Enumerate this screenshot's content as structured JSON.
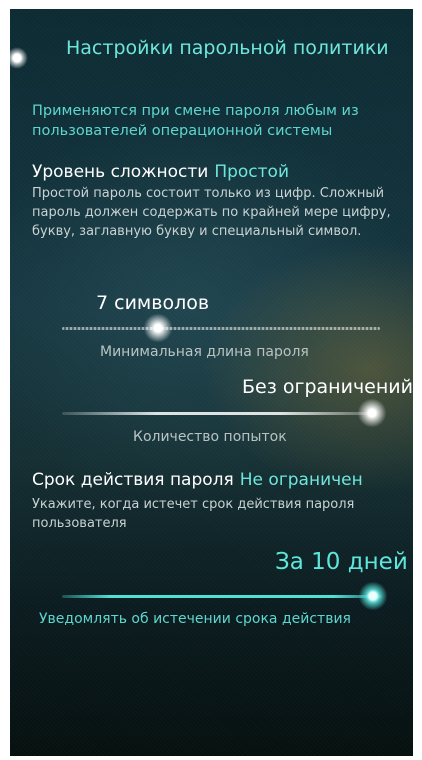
{
  "header": {
    "title": "Настройки парольной политики",
    "description": "Применяются при смене пароля любым из пользователей операционной системы"
  },
  "complexity": {
    "label": "Уровень сложности",
    "value": "Простой",
    "description": "Простой пароль состоит только из цифр. Сложный пароль должен содержать по крайней мере цифру, букву, заглавную букву и специальный символ."
  },
  "min_length": {
    "value_text": "7 символов",
    "label": "Минимальная длина пароля"
  },
  "attempts": {
    "value_text": "Без ограничений",
    "label": "Количество попыток"
  },
  "expiry": {
    "label": "Срок действия пароля",
    "value": "Не ограничен",
    "description": "Укажите, когда истечет срок действия пароля пользователя"
  },
  "notify": {
    "value_text": "За 10 дней",
    "label": "Уведомлять об истечении срока действия"
  },
  "colors": {
    "accent": "#6fe6dc",
    "text": "#ffffff",
    "secondary": "#c9d2d3"
  }
}
